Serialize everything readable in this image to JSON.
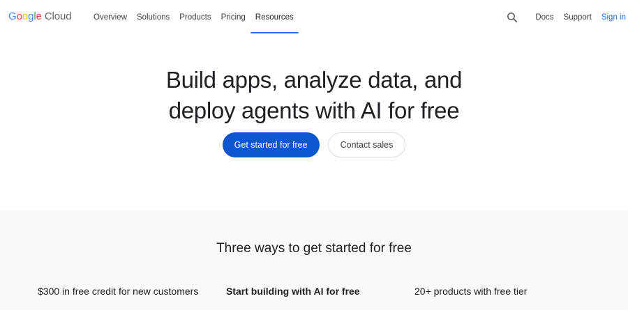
{
  "header": {
    "logo": {
      "word_letters": [
        "G",
        "o",
        "o",
        "g",
        "l",
        "e"
      ],
      "product": "Cloud"
    },
    "nav": [
      {
        "label": "Overview",
        "active": false
      },
      {
        "label": "Solutions",
        "active": false
      },
      {
        "label": "Products",
        "active": false
      },
      {
        "label": "Pricing",
        "active": false
      },
      {
        "label": "Resources",
        "active": true
      }
    ],
    "search_icon": "search-icon",
    "docs_label": "Docs",
    "support_label": "Support",
    "signin_label": "Sign in"
  },
  "hero": {
    "title_line1": "Build apps, analyze data, and",
    "title_line2": "deploy agents with AI for free",
    "primary_cta": "Get started for free",
    "secondary_cta": "Contact sales"
  },
  "section": {
    "title": "Three ways to get started for free",
    "ways": [
      {
        "label": "$300 in free credit for new customers"
      },
      {
        "label": "Start building with AI for free"
      },
      {
        "label": "20+ products with free tier"
      }
    ]
  },
  "colors": {
    "accent": "#1a73e8",
    "primary_button": "#0b57d0",
    "section_bg": "#f8f9fa",
    "text": "#202124"
  }
}
